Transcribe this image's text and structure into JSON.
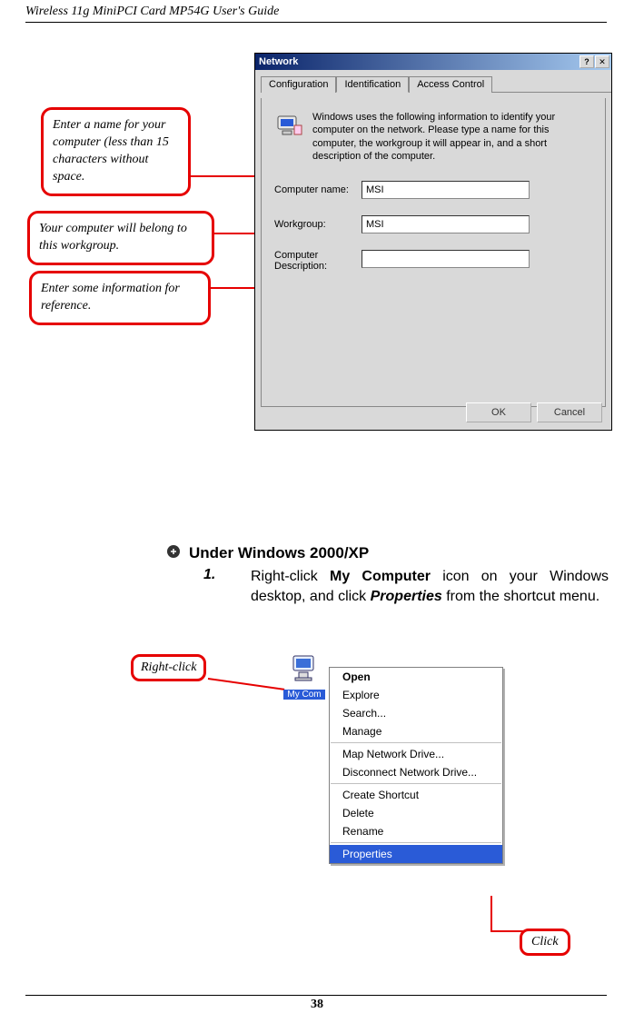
{
  "header": {
    "title": "Wireless 11g MiniPCI Card MP54G User's Guide"
  },
  "dialog": {
    "title": "Network",
    "tabs": [
      "Configuration",
      "Identification",
      "Access Control"
    ],
    "active_tab": "Identification",
    "info": "Windows uses the following information to identify your computer on the network. Please type a name for this computer, the workgroup it will appear in, and a short description of the computer.",
    "computer_name_label": "Computer name:",
    "computer_name_value": "MSI",
    "workgroup_label": "Workgroup:",
    "workgroup_value": "MSI",
    "description_label": "Computer Description:",
    "description_value": "",
    "ok": "OK",
    "cancel": "Cancel"
  },
  "callouts": {
    "c1": "Enter a name for your computer (less than 15 characters without space.",
    "c2": "Your computer will belong to this workgroup.",
    "c3": "Enter some information for reference.",
    "right_click": "Right-click",
    "click": "Click"
  },
  "section2": {
    "title": "Under Windows 2000/XP",
    "step_num": "1.",
    "step_text_pre": "Right-click ",
    "step_text_bold1": "My Computer",
    "step_text_mid": " icon on your Windows desktop, and click ",
    "step_text_bold2": "Properties",
    "step_text_post": " from the shortcut menu."
  },
  "mycomputer": {
    "label": "My Com"
  },
  "context_menu": {
    "items": [
      "Open",
      "Explore",
      "Search...",
      "Manage",
      "Map Network Drive...",
      "Disconnect Network Drive...",
      "Create Shortcut",
      "Delete",
      "Rename",
      "Properties"
    ]
  },
  "page_num": "38"
}
